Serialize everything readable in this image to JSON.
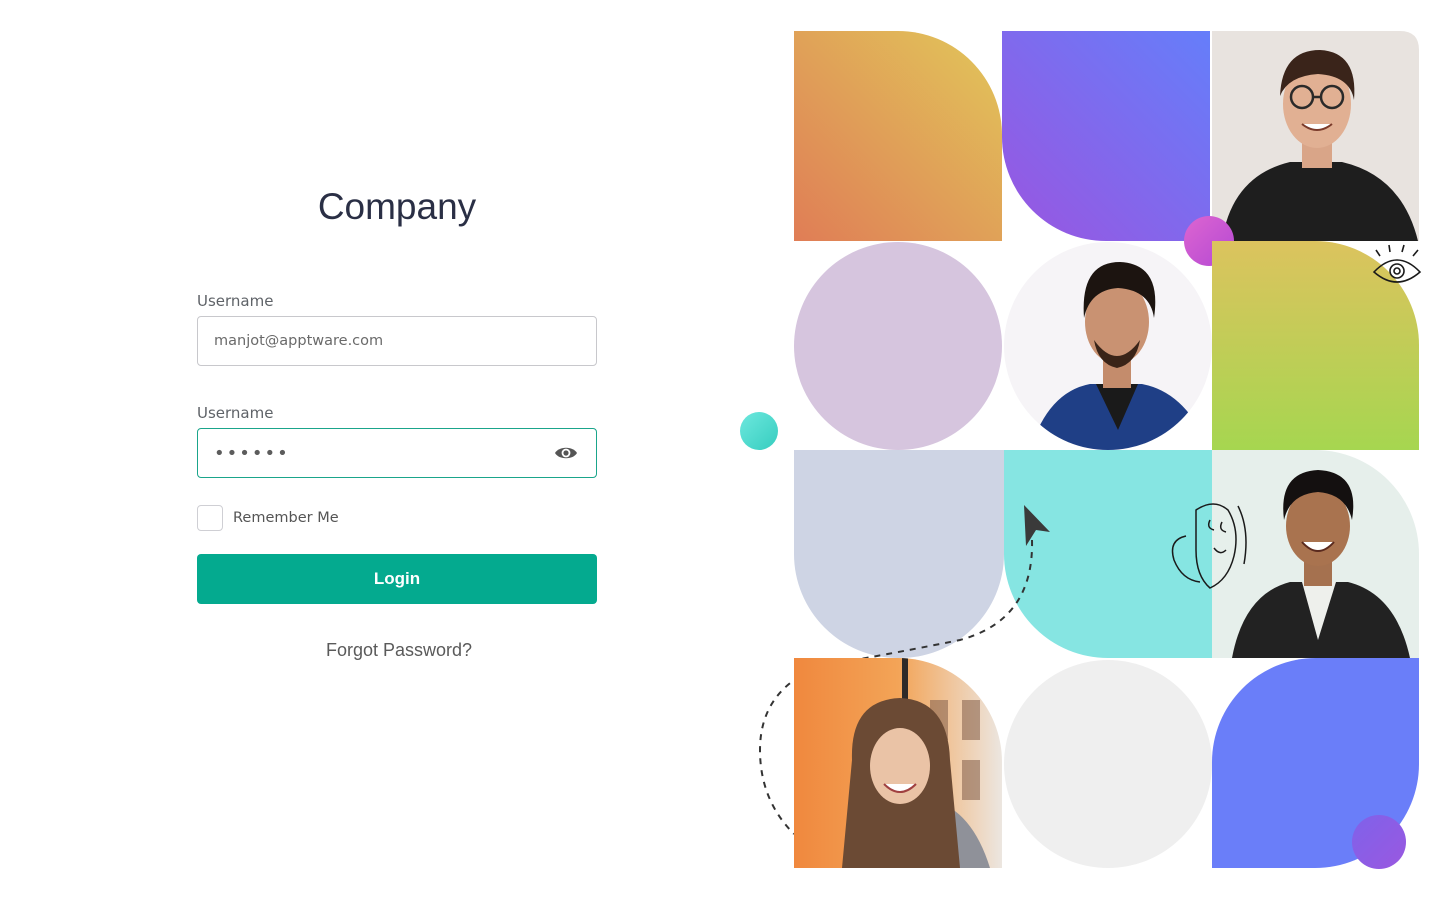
{
  "brand": {
    "title": "Company"
  },
  "form": {
    "username_label": "Username",
    "username_value": "manjot@apptware.com",
    "password_label": "Username",
    "password_value": "••••••",
    "remember_label": "Remember Me",
    "remember_checked": false,
    "login_label": "Login",
    "forgot_label": "Forgot Password?"
  },
  "icons": {
    "password_toggle": "eye-icon",
    "doodle_eye": "eye-doodle-icon",
    "doodle_face": "face-doodle-icon",
    "paper_plane": "paper-plane-icon"
  },
  "colors": {
    "accent": "#04aa8f",
    "focus_border": "#1aa58b",
    "title": "#2a2f45"
  }
}
